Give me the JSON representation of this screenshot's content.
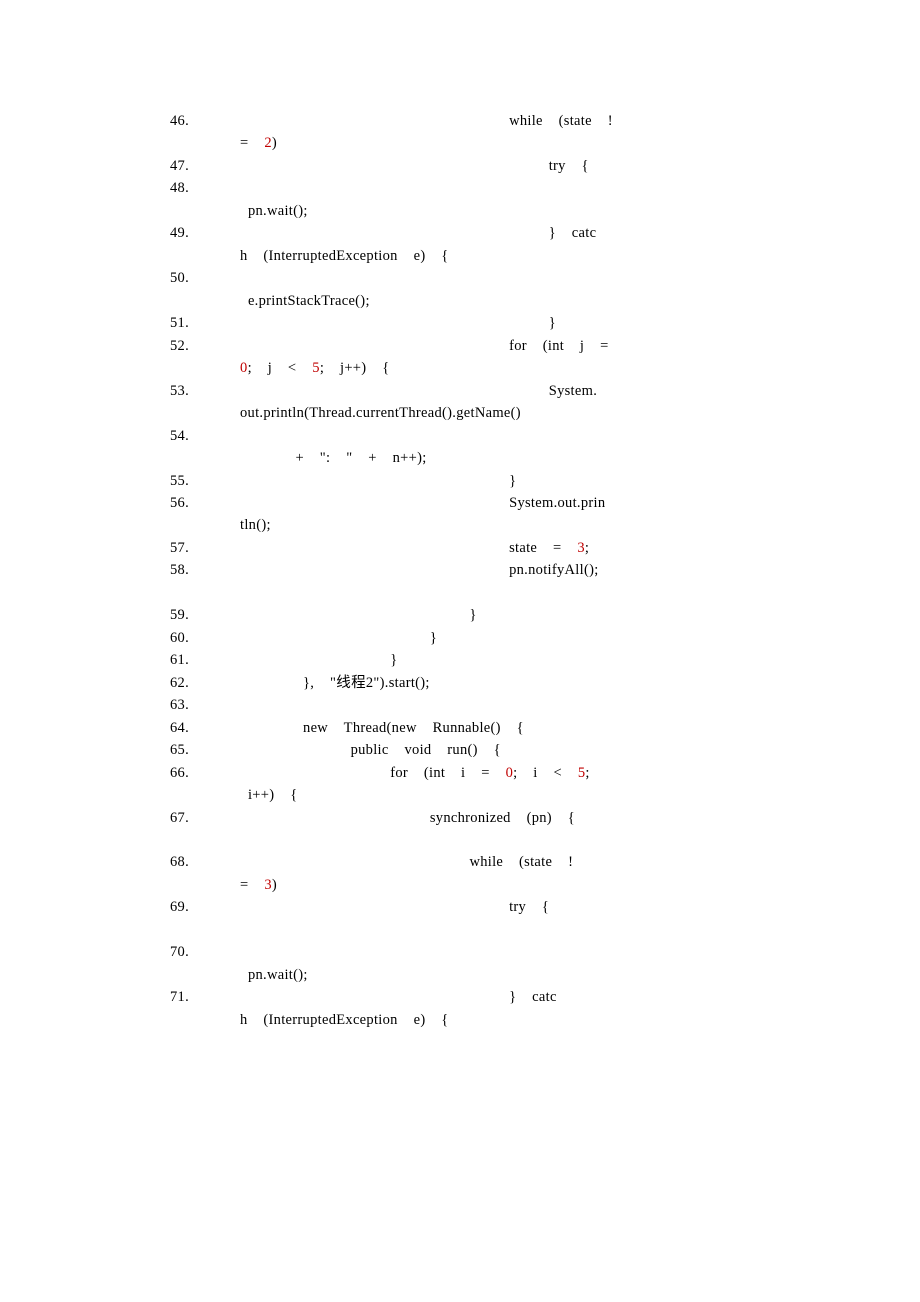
{
  "code": {
    "lines": [
      {
        "segments": [
          {
            "t": "                                       while  (state  !"
          },
          {
            "t": "\n=  "
          },
          {
            "t": "2",
            "c": "num"
          },
          {
            "t": ")  "
          }
        ]
      },
      {
        "segments": [
          {
            "t": "                                            try  {  "
          }
        ]
      },
      {
        "segments": [
          {
            "t": "                                               "
          },
          {
            "t": "\n pn.wait();  "
          }
        ]
      },
      {
        "segments": [
          {
            "t": "                                            }  catc"
          },
          {
            "t": "\nh  (InterruptedException  e)  {  "
          }
        ]
      },
      {
        "segments": [
          {
            "t": "                                               "
          },
          {
            "t": "\n e.printStackTrace();  "
          }
        ]
      },
      {
        "segments": [
          {
            "t": "                                            }  "
          }
        ]
      },
      {
        "segments": [
          {
            "t": "                                       for  (int  j  =  "
          },
          {
            "t": "\n"
          },
          {
            "t": "0",
            "c": "num"
          },
          {
            "t": ";  j  <  "
          },
          {
            "t": "5",
            "c": "num"
          },
          {
            "t": ";  j++)  {  "
          }
        ]
      },
      {
        "segments": [
          {
            "t": "                                            System."
          },
          {
            "t": "\nout.println(Thread.currentThread().getName()  "
          }
        ]
      },
      {
        "segments": [
          {
            "t": "                                                 "
          },
          {
            "t": "\n       +  \":  \"  +  n++);  "
          }
        ]
      },
      {
        "segments": [
          {
            "t": "                                       }  "
          }
        ]
      },
      {
        "segments": [
          {
            "t": "                                       System.out.prin"
          },
          {
            "t": "\ntln();  "
          }
        ]
      },
      {
        "segments": [
          {
            "t": "                                       state  =  "
          },
          {
            "t": "3",
            "c": "num"
          },
          {
            "t": ";  "
          }
        ]
      },
      {
        "segments": [
          {
            "t": "                                       pn.notifyAll();"
          },
          {
            "t": "\n  "
          }
        ]
      },
      {
        "segments": [
          {
            "t": "                                  }  "
          }
        ]
      },
      {
        "segments": [
          {
            "t": "                             }  "
          }
        ]
      },
      {
        "segments": [
          {
            "t": "                        }  "
          }
        ]
      },
      {
        "segments": [
          {
            "t": "             },  \"线程2\").start();  "
          }
        ]
      },
      {
        "segments": [
          {
            "t": "   "
          }
        ]
      },
      {
        "segments": [
          {
            "t": "             new  Thread(new  Runnable()  {  "
          }
        ]
      },
      {
        "segments": [
          {
            "t": "                   public  void  run()  {  "
          }
        ]
      },
      {
        "segments": [
          {
            "t": "                        for  (int  i  =  "
          },
          {
            "t": "0",
            "c": "num"
          },
          {
            "t": ";  i  <  "
          },
          {
            "t": "5",
            "c": "num"
          },
          {
            "t": ";  "
          },
          {
            "t": "\n i++)  {  "
          }
        ]
      },
      {
        "segments": [
          {
            "t": "                             synchronized  (pn)  {  "
          },
          {
            "t": "\n  "
          }
        ]
      },
      {
        "segments": [
          {
            "t": "                                  while  (state  !"
          },
          {
            "t": "\n=  "
          },
          {
            "t": "3",
            "c": "num"
          },
          {
            "t": ")  "
          }
        ]
      },
      {
        "segments": [
          {
            "t": "                                       try  {  "
          },
          {
            "t": "\n  "
          }
        ]
      },
      {
        "segments": [
          {
            "t": "                                               "
          },
          {
            "t": "\n pn.wait();  "
          }
        ]
      },
      {
        "segments": [
          {
            "t": "                                       }  catc"
          },
          {
            "t": "\nh  (InterruptedException  e)  {  "
          }
        ]
      }
    ]
  }
}
